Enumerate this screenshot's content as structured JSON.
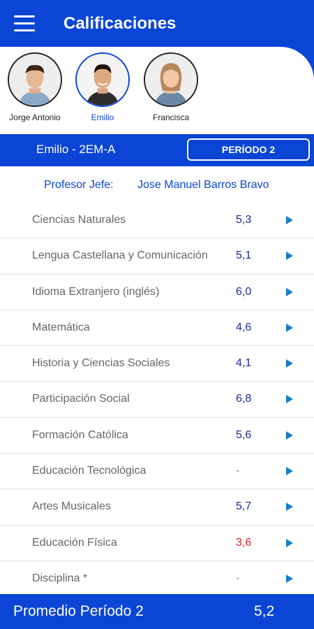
{
  "header": {
    "title": "Calificaciones",
    "menu_icon": "hamburger-menu-icon"
  },
  "students": [
    {
      "name": "Jorge Antonio",
      "selected": false
    },
    {
      "name": "Emilio",
      "selected": true
    },
    {
      "name": "Francisca",
      "selected": false
    }
  ],
  "info": {
    "student_course": "Emilio - 2EM-A",
    "period_button": "PERÍODO 2"
  },
  "teacher": {
    "label": "Profesor Jefe:",
    "name": "Jose Manuel Barros Bravo"
  },
  "subjects": [
    {
      "name": "Ciencias Naturales",
      "grade": "5,3"
    },
    {
      "name": "Lengua Castellana y Comunicación",
      "grade": "5,1"
    },
    {
      "name": "Idioma Extranjero (inglés)",
      "grade": "6,0"
    },
    {
      "name": "Matemática",
      "grade": "4,6"
    },
    {
      "name": "Historia y Ciencias Sociales",
      "grade": "4,1"
    },
    {
      "name": "Participación Social",
      "grade": "6,8"
    },
    {
      "name": "Formación Católica",
      "grade": "5,6"
    },
    {
      "name": "Educación Tecnológica",
      "grade": "-"
    },
    {
      "name": "Artes Musicales",
      "grade": "5,7"
    },
    {
      "name": "Educación Física",
      "grade": "3,6"
    },
    {
      "name": "Disciplina *",
      "grade": "-"
    }
  ],
  "footer": {
    "label": "Promedio Período 2",
    "value": "5,2"
  },
  "colors": {
    "primary": "#0a45d6",
    "grade": "#1a2aa0",
    "failing": "#d92323",
    "arrow": "#1380c8"
  }
}
